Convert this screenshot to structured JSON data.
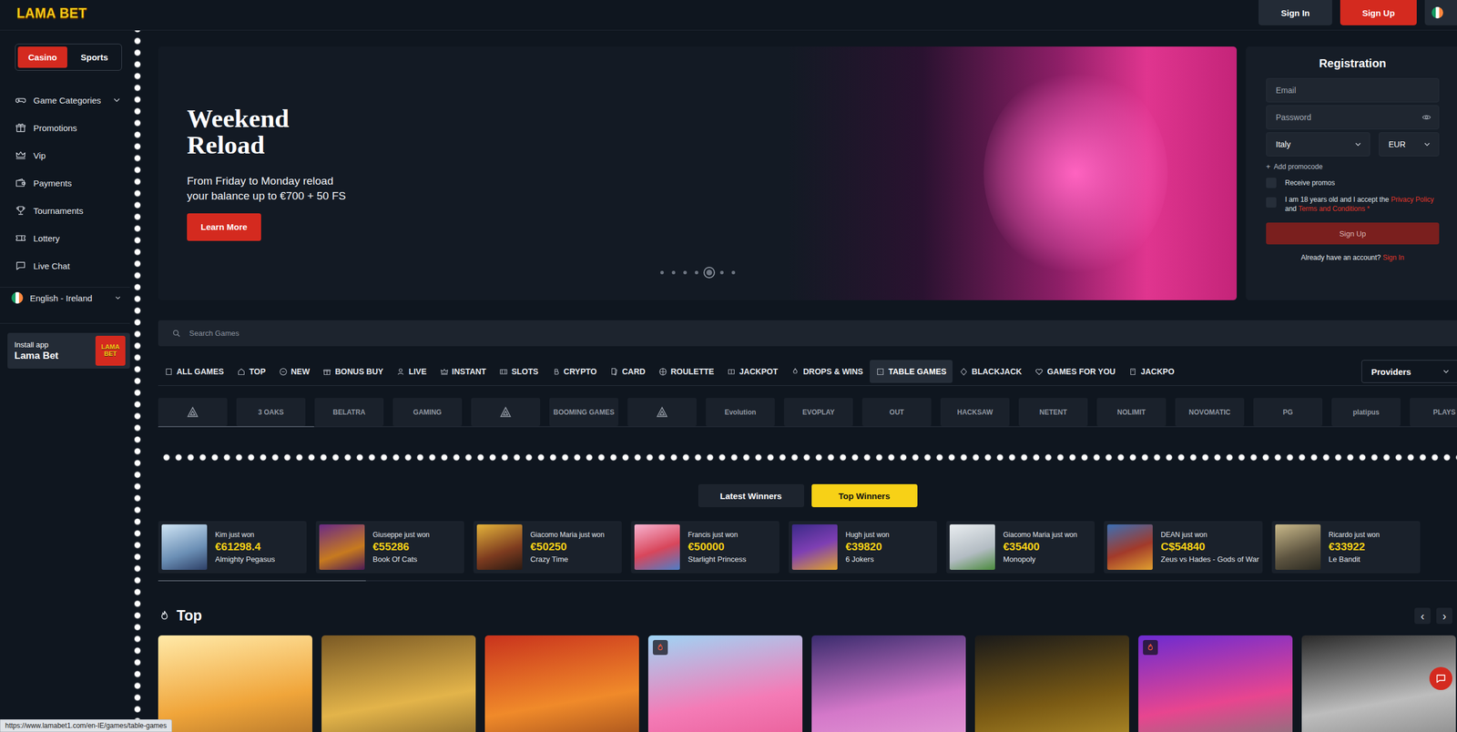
{
  "topbar": {
    "logo": "LAMA BET",
    "sign_in": "Sign In",
    "sign_up": "Sign Up"
  },
  "sidebar": {
    "mode_toggle": [
      {
        "label": "Casino",
        "selected": true
      },
      {
        "label": "Sports",
        "selected": false
      }
    ],
    "items": [
      {
        "label": "Game Categories",
        "expandable": true,
        "expanded": false
      },
      {
        "label": "Promotions",
        "expandable": false,
        "expanded": false
      },
      {
        "label": "Vip",
        "expandable": false,
        "expanded": false
      },
      {
        "label": "Payments",
        "expandable": false,
        "expanded": false
      },
      {
        "label": "Tournaments",
        "expandable": false,
        "expanded": false
      },
      {
        "label": "Lottery",
        "expandable": false,
        "expanded": false
      },
      {
        "label": "Live Chat",
        "expandable": false,
        "expanded": false
      }
    ],
    "language": "English - Ireland",
    "install": {
      "title": "Install app",
      "name": "Lama Bet",
      "logo": "LAMA BET"
    }
  },
  "hero": {
    "title": "Weekend Reload",
    "subtitle": "From Friday to Monday reload your balance up to €700 + 50 FS",
    "button": "Learn More",
    "dots": [
      {
        "selected": false
      },
      {
        "selected": false
      },
      {
        "selected": false
      },
      {
        "selected": false
      },
      {
        "selected": true
      },
      {
        "selected": false
      },
      {
        "selected": false
      }
    ]
  },
  "registration": {
    "title": "Registration",
    "email_placeholder": "Email",
    "password_placeholder": "Password",
    "country": "Italy",
    "currency": "EUR",
    "promocode_icon": "+",
    "promocode": "Add promocode",
    "receive_promos": {
      "label": "Receive promos",
      "checked": false
    },
    "terms": {
      "checked": false,
      "text": "I am 18 years old and I accept the",
      "privacy": "Privacy Policy",
      "and": "and",
      "conditions": "Terms and Conditions",
      "required": "*"
    },
    "button": {
      "label": "Sign Up",
      "disabled": true
    },
    "footer": "Already have an account?",
    "footer_link": "Sign In"
  },
  "search": {
    "placeholder": "Search Games"
  },
  "categories": [
    {
      "label": "ALL GAMES",
      "selected": false
    },
    {
      "label": "TOP",
      "selected": false
    },
    {
      "label": "NEW",
      "selected": false
    },
    {
      "label": "BONUS BUY",
      "selected": false
    },
    {
      "label": "LIVE",
      "selected": false
    },
    {
      "label": "INSTANT",
      "selected": false
    },
    {
      "label": "SLOTS",
      "selected": false
    },
    {
      "label": "CRYPTO",
      "selected": false
    },
    {
      "label": "CARD",
      "selected": false
    },
    {
      "label": "ROULETTE",
      "selected": false
    },
    {
      "label": "JACKPOT",
      "selected": false
    },
    {
      "label": "DROPS & WINS",
      "selected": false
    },
    {
      "label": "TABLE GAMES",
      "selected": true
    },
    {
      "label": "BLACKJACK",
      "selected": false
    },
    {
      "label": "GAMES FOR YOU",
      "selected": false
    },
    {
      "label": "JACKPO",
      "selected": false
    }
  ],
  "providers_button": "Providers",
  "providers": [
    {
      "kind": "icon",
      "label": ""
    },
    {
      "kind": "text",
      "label": "3 OAKS"
    },
    {
      "kind": "text",
      "label": "BELATRA"
    },
    {
      "kind": "text",
      "label": "GAMING"
    },
    {
      "kind": "icon",
      "label": ""
    },
    {
      "kind": "text",
      "label": "BOOMING GAMES"
    },
    {
      "kind": "icon",
      "label": ""
    },
    {
      "kind": "text",
      "label": "Evolution"
    },
    {
      "kind": "text",
      "label": "EVOPLAY"
    },
    {
      "kind": "text",
      "label": "OUT"
    },
    {
      "kind": "text",
      "label": "HACKSAW"
    },
    {
      "kind": "text",
      "label": "NETENT"
    },
    {
      "kind": "text",
      "label": "NOLIMIT"
    },
    {
      "kind": "text",
      "label": "NOVOMATIC"
    },
    {
      "kind": "text",
      "label": "PG"
    },
    {
      "kind": "text",
      "label": "platipus"
    },
    {
      "kind": "text",
      "label": "PLAYS"
    }
  ],
  "providers_scroll": {
    "level": 0.12
  },
  "winners": {
    "tabs": [
      {
        "label": "Latest Winners",
        "selected": false
      },
      {
        "label": "Top Winners",
        "selected": true
      }
    ],
    "items": [
      {
        "name": "Kim just won",
        "amount": "€61298.4",
        "game": "Almighty Pegasus"
      },
      {
        "name": "Giuseppe just won",
        "amount": "€55286",
        "game": "Book Of Cats"
      },
      {
        "name": "Giacomo Maria just won",
        "amount": "€50250",
        "game": "Crazy Time"
      },
      {
        "name": "Francis just won",
        "amount": "€50000",
        "game": "Starlight Princess"
      },
      {
        "name": "Hugh just won",
        "amount": "€39820",
        "game": "6 Jokers"
      },
      {
        "name": "Giacomo Maria just won",
        "amount": "€35400",
        "game": "Monopoly"
      },
      {
        "name": "DEAN just won",
        "amount": "C$54840",
        "game": "Zeus vs Hades - Gods of War"
      },
      {
        "name": "Ricardo just won",
        "amount": "€33922",
        "game": "Le Bandit"
      }
    ],
    "scroll_level": 0.16
  },
  "top": {
    "title": "Top",
    "prev": "‹",
    "next": "›",
    "games": [
      {
        "hot": false
      },
      {
        "hot": false
      },
      {
        "hot": false
      },
      {
        "hot": true
      },
      {
        "hot": false
      },
      {
        "hot": false
      },
      {
        "hot": true
      },
      {
        "hot": false
      }
    ]
  },
  "status_bar": "https://www.lamabet1.com/en-IE/games/table-games"
}
